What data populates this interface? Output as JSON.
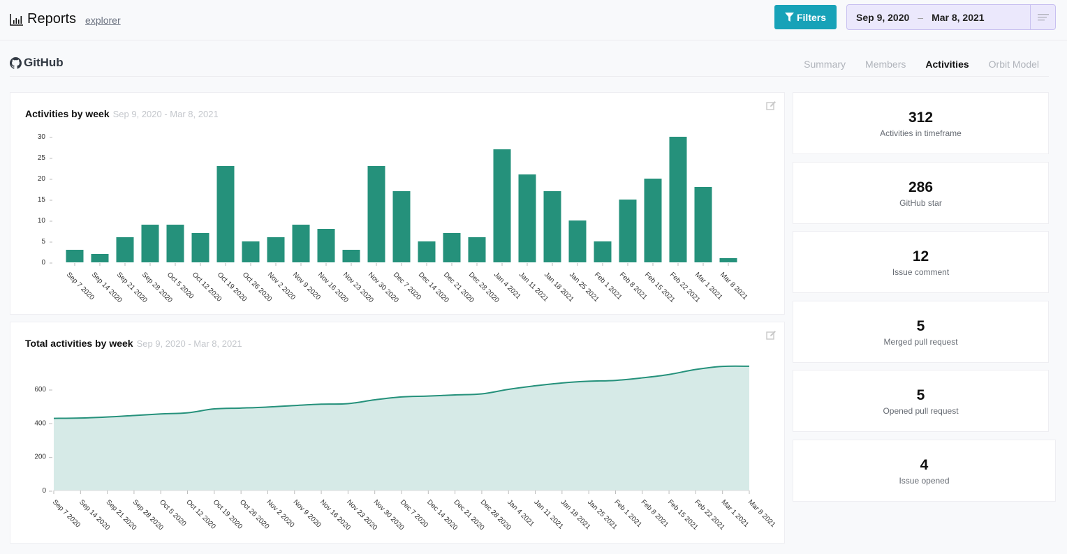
{
  "header": {
    "title": "Reports",
    "subtitle_link": "explorer",
    "filters_label": "Filters",
    "date_range": {
      "start": "Sep 9, 2020",
      "separator": "–",
      "end": "Mar 8, 2021"
    }
  },
  "section": {
    "source_name": "GitHub",
    "tabs": [
      {
        "label": "Summary",
        "active": false
      },
      {
        "label": "Members",
        "active": false
      },
      {
        "label": "Activities",
        "active": true
      },
      {
        "label": "Orbit Model",
        "active": false
      }
    ]
  },
  "colors": {
    "accent": "#17a2b8",
    "bar": "#25917b",
    "area_fill": "#d6eae7",
    "area_line": "#25917b",
    "date_bg": "#ebe8fc"
  },
  "stats": [
    {
      "value": "312",
      "label": "Activities in timeframe"
    },
    {
      "value": "286",
      "label": "GitHub star"
    },
    {
      "value": "12",
      "label": "Issue comment"
    },
    {
      "value": "5",
      "label": "Merged pull request"
    },
    {
      "value": "5",
      "label": "Opened pull request"
    },
    {
      "value": "4",
      "label": "Issue opened"
    }
  ],
  "chart_data": [
    {
      "type": "bar",
      "title": "Activities by week",
      "subtitle": "Sep 9, 2020 - Mar 8, 2021",
      "xlabel": "",
      "ylabel": "",
      "ylim": [
        0,
        30
      ],
      "yticks": [
        0,
        5,
        10,
        15,
        20,
        25,
        30
      ],
      "grid": false,
      "categories": [
        "Sep 7 2020",
        "Sep 14 2020",
        "Sep 21 2020",
        "Sep 28 2020",
        "Oct 5 2020",
        "Oct 12 2020",
        "Oct 19 2020",
        "Oct 26 2020",
        "Nov 2 2020",
        "Nov 9 2020",
        "Nov 16 2020",
        "Nov 23 2020",
        "Nov 30 2020",
        "Dec 7 2020",
        "Dec 14 2020",
        "Dec 21 2020",
        "Dec 28 2020",
        "Jan 4 2021",
        "Jan 11 2021",
        "Jan 18 2021",
        "Jan 25 2021",
        "Feb 1 2021",
        "Feb 8 2021",
        "Feb 15 2021",
        "Feb 22 2021",
        "Mar 1 2021",
        "Mar 8 2021"
      ],
      "values": [
        3,
        2,
        6,
        9,
        9,
        7,
        23,
        5,
        6,
        9,
        8,
        3,
        23,
        17,
        5,
        7,
        6,
        27,
        21,
        17,
        10,
        5,
        15,
        20,
        30,
        18,
        1
      ]
    },
    {
      "type": "area",
      "title": "Total activities by week",
      "subtitle": "Sep 9, 2020 - Mar 8, 2021",
      "xlabel": "",
      "ylabel": "",
      "ylim": [
        0,
        600
      ],
      "yticks": [
        0,
        200,
        400,
        600
      ],
      "grid": false,
      "categories": [
        "Sep 7 2020",
        "Sep 14 2020",
        "Sep 21 2020",
        "Sep 28 2020",
        "Oct 5 2020",
        "Oct 12 2020",
        "Oct 19 2020",
        "Oct 26 2020",
        "Nov 2 2020",
        "Nov 9 2020",
        "Nov 16 2020",
        "Nov 23 2020",
        "Nov 30 2020",
        "Dec 7 2020",
        "Dec 14 2020",
        "Dec 21 2020",
        "Dec 28 2020",
        "Jan 4 2021",
        "Jan 11 2021",
        "Jan 18 2021",
        "Jan 25 2021",
        "Feb 1 2021",
        "Feb 8 2021",
        "Feb 15 2021",
        "Feb 22 2021",
        "Mar 1 2021",
        "Mar 8 2021"
      ],
      "values": [
        428,
        430,
        436,
        445,
        454,
        461,
        484,
        489,
        495,
        504,
        512,
        515,
        538,
        555,
        560,
        567,
        573,
        600,
        621,
        638,
        648,
        653,
        668,
        688,
        718,
        736,
        737
      ]
    }
  ]
}
